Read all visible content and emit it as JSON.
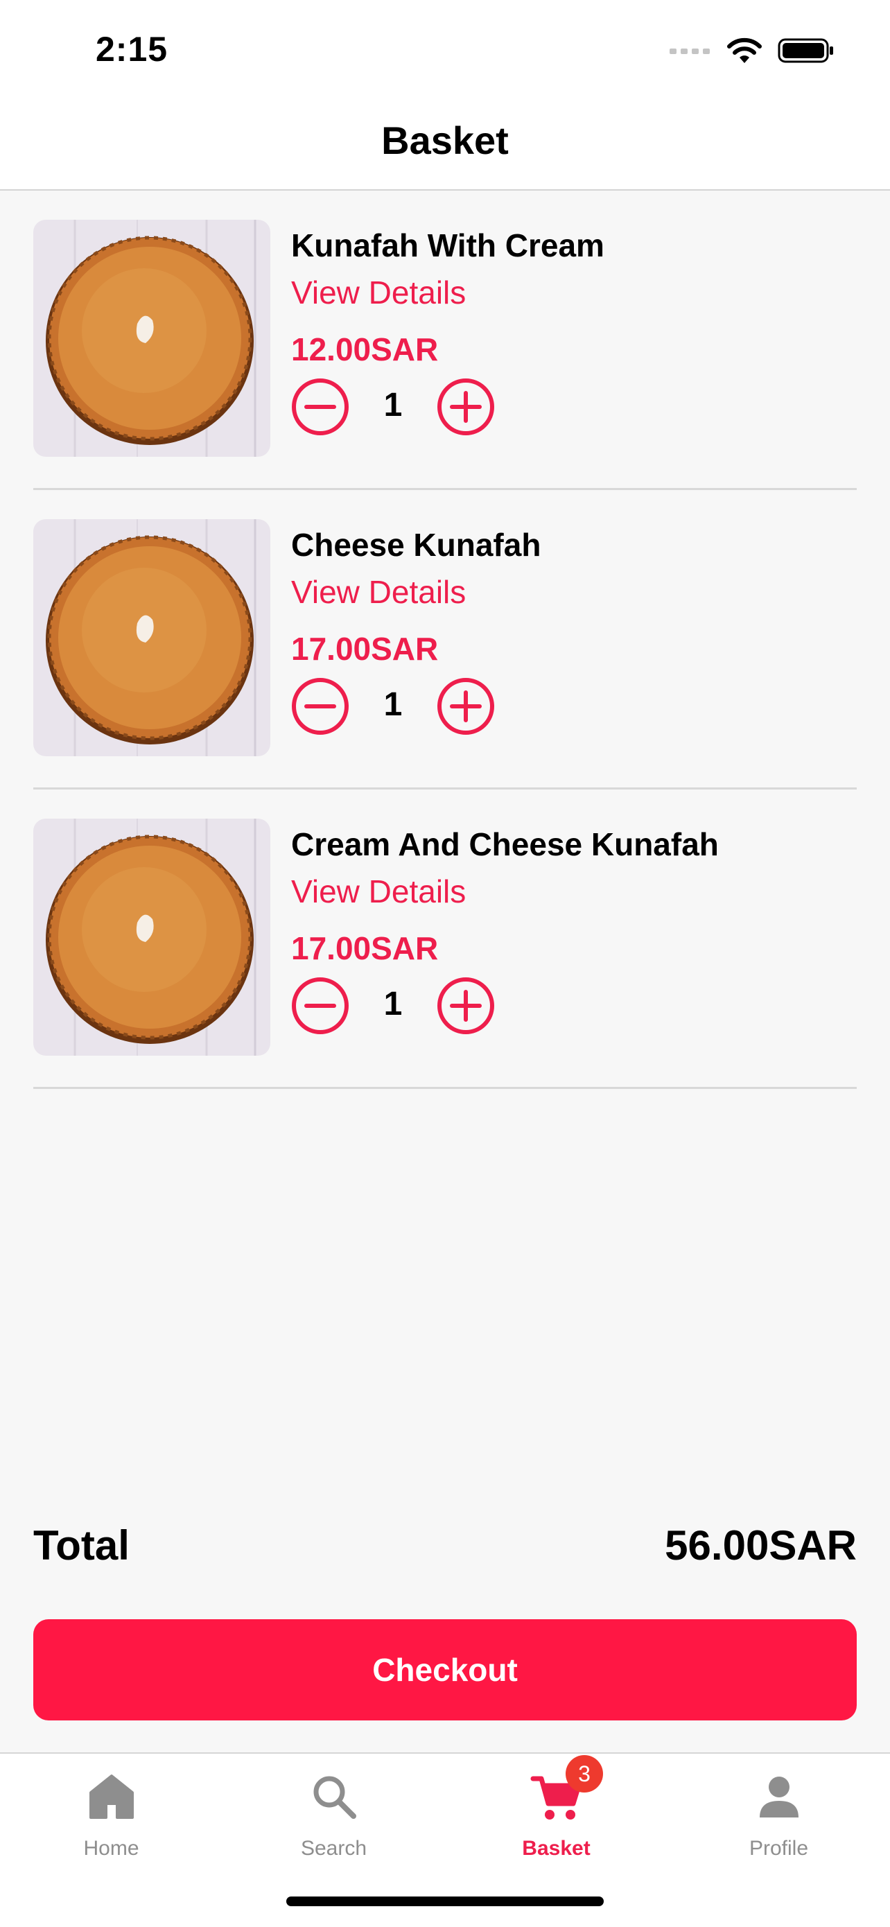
{
  "status_bar": {
    "time": "2:15"
  },
  "header": {
    "title": "Basket"
  },
  "basket": {
    "items": [
      {
        "name": "Kunafah With Cream",
        "details_label": "View Details",
        "price": "12.00SAR",
        "quantity": "1"
      },
      {
        "name": "Cheese Kunafah",
        "details_label": "View Details",
        "price": "17.00SAR",
        "quantity": "1"
      },
      {
        "name": "Cream And Cheese Kunafah",
        "details_label": "View Details",
        "price": "17.00SAR",
        "quantity": "1"
      }
    ]
  },
  "summary": {
    "total_label": "Total",
    "total_value": "56.00SAR"
  },
  "checkout": {
    "label": "Checkout"
  },
  "tab_bar": {
    "tabs": [
      {
        "label": "Home",
        "icon": "home-icon",
        "active": false
      },
      {
        "label": "Search",
        "icon": "search-icon",
        "active": false
      },
      {
        "label": "Basket",
        "icon": "cart-icon",
        "active": true,
        "badge": "3"
      },
      {
        "label": "Profile",
        "icon": "person-icon",
        "active": false
      }
    ]
  },
  "colors": {
    "accent": "#ee1e4c",
    "checkout": "#ff1744",
    "badge": "#ee3a2e",
    "inactive": "#8e8e8e"
  }
}
